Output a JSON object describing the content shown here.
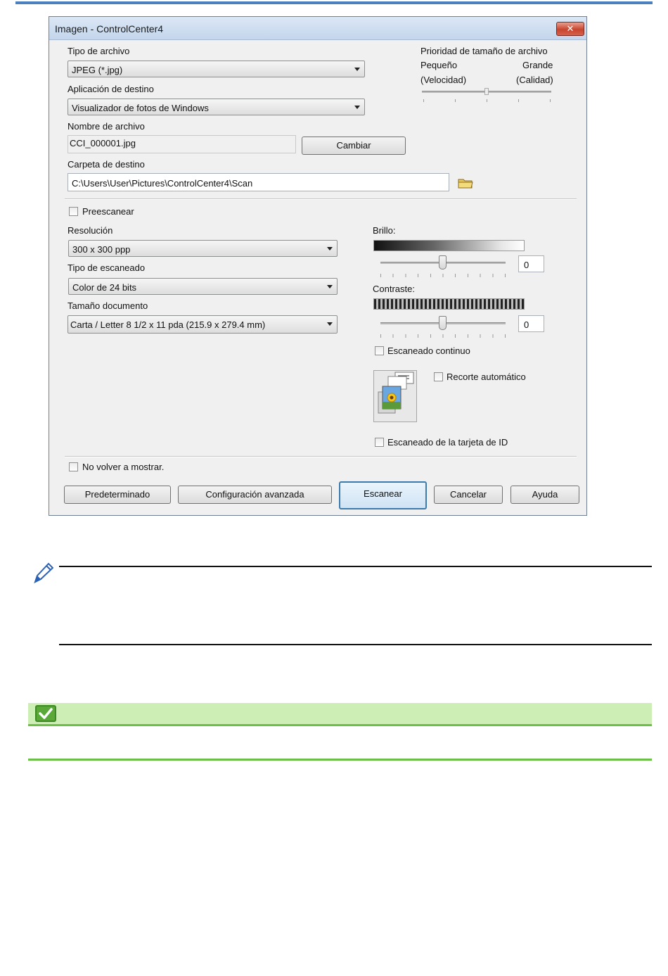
{
  "dialog": {
    "title": "Imagen - ControlCenter4",
    "close_label": "✕",
    "file_type": {
      "label": "Tipo de archivo",
      "value": "JPEG (*.jpg)"
    },
    "size_priority": {
      "label": "Prioridad de tamaño de archivo",
      "small": "Pequeño",
      "large": "Grande",
      "small_sub": "(Velocidad)",
      "large_sub": "(Calidad)",
      "level": 0.5
    },
    "target_app": {
      "label": "Aplicación de destino",
      "value": "Visualizador de fotos de Windows"
    },
    "file_name": {
      "label": "Nombre de archivo",
      "value": "CCI_000001.jpg",
      "change_button": "Cambiar"
    },
    "dest_folder": {
      "label": "Carpeta de destino",
      "value": "C:\\Users\\User\\Pictures\\ControlCenter4\\Scan"
    },
    "prescan": {
      "label": "Preescanear",
      "checked": false
    },
    "resolution": {
      "label": "Resolución",
      "value": "300 x 300 ppp"
    },
    "scan_type": {
      "label": "Tipo de escaneado",
      "value": "Color de 24 bits"
    },
    "doc_size": {
      "label": "Tamaño documento",
      "value": "Carta / Letter 8 1/2 x 11 pda (215.9 x 279.4 mm)"
    },
    "brightness": {
      "label": "Brillo:",
      "value": "0"
    },
    "contrast": {
      "label": "Contraste:",
      "value": "0"
    },
    "continuous_scan": {
      "label": "Escaneado continuo",
      "checked": false
    },
    "auto_crop": {
      "label": "Recorte automático",
      "checked": false
    },
    "id_card_scan": {
      "label": "Escaneado de la tarjeta de ID",
      "checked": false
    },
    "dont_show": {
      "label": "No volver a mostrar.",
      "checked": false
    },
    "buttons": {
      "default": "Predeterminado",
      "advanced": "Configuración avanzada",
      "scan": "Escanear",
      "cancel": "Cancelar",
      "help": "Ayuda"
    }
  },
  "colors": {
    "accent_blue": "#4c7fbd",
    "green": "#6cc04a",
    "green_bg": "#cdeeb5"
  },
  "icons": [
    "pencil-note-icon",
    "checkmark-icon",
    "folder-icon",
    "photo-preview-icon"
  ]
}
